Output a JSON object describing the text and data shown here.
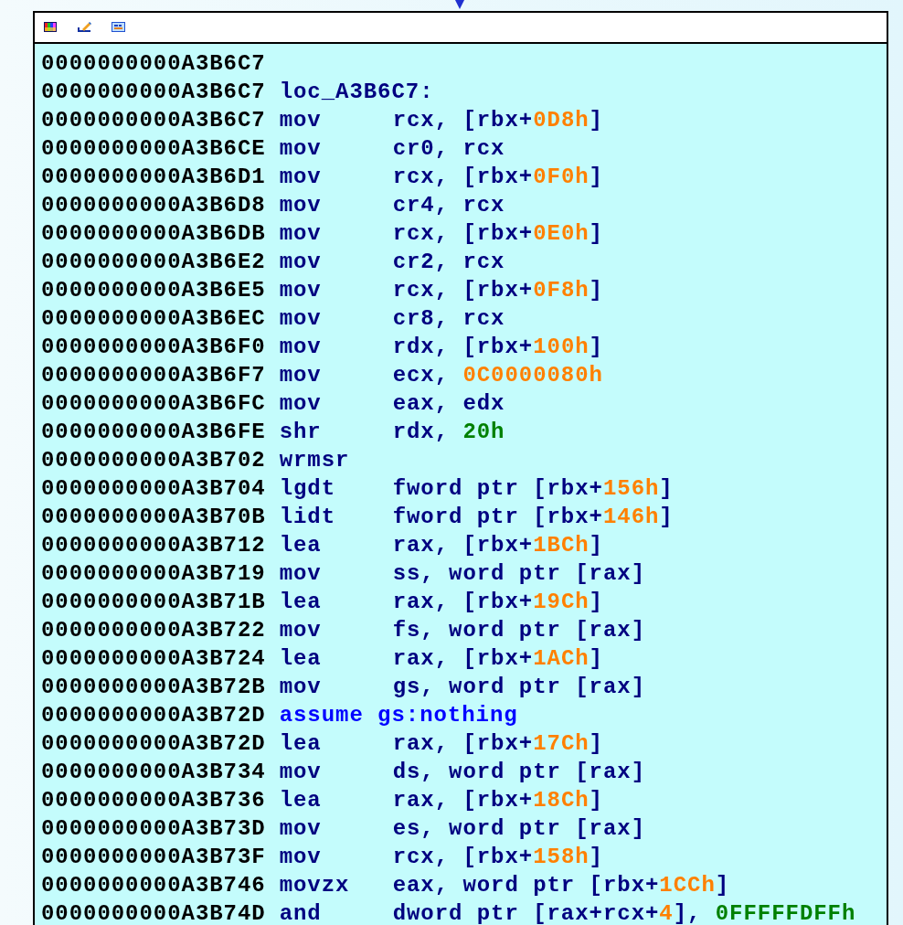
{
  "toolbar": {
    "icons": [
      {
        "kind": "palette"
      },
      {
        "kind": "pencil"
      },
      {
        "kind": "window"
      }
    ]
  },
  "lines": [
    {
      "address": "0000000000A3B6C7"
    },
    {
      "address": "0000000000A3B6C7",
      "parts": [
        {
          "kind": "label",
          "text": "loc_A3B6C7:"
        }
      ]
    },
    {
      "address": "0000000000A3B6C7",
      "parts": [
        {
          "kind": "mnemonic",
          "text": "mov"
        },
        {
          "kind": "text",
          "text": "rcx, [rbx+"
        },
        {
          "kind": "offset",
          "text": "0D8h"
        },
        {
          "kind": "text",
          "text": "]"
        }
      ]
    },
    {
      "address": "0000000000A3B6CE",
      "parts": [
        {
          "kind": "mnemonic",
          "text": "mov"
        },
        {
          "kind": "text",
          "text": "cr0, rcx"
        }
      ]
    },
    {
      "address": "0000000000A3B6D1",
      "parts": [
        {
          "kind": "mnemonic",
          "text": "mov"
        },
        {
          "kind": "text",
          "text": "rcx, [rbx+"
        },
        {
          "kind": "offset",
          "text": "0F0h"
        },
        {
          "kind": "text",
          "text": "]"
        }
      ]
    },
    {
      "address": "0000000000A3B6D8",
      "parts": [
        {
          "kind": "mnemonic",
          "text": "mov"
        },
        {
          "kind": "text",
          "text": "cr4, rcx"
        }
      ]
    },
    {
      "address": "0000000000A3B6DB",
      "parts": [
        {
          "kind": "mnemonic",
          "text": "mov"
        },
        {
          "kind": "text",
          "text": "rcx, [rbx+"
        },
        {
          "kind": "offset",
          "text": "0E0h"
        },
        {
          "kind": "text",
          "text": "]"
        }
      ]
    },
    {
      "address": "0000000000A3B6E2",
      "parts": [
        {
          "kind": "mnemonic",
          "text": "mov"
        },
        {
          "kind": "text",
          "text": "cr2, rcx"
        }
      ]
    },
    {
      "address": "0000000000A3B6E5",
      "parts": [
        {
          "kind": "mnemonic",
          "text": "mov"
        },
        {
          "kind": "text",
          "text": "rcx, [rbx+"
        },
        {
          "kind": "offset",
          "text": "0F8h"
        },
        {
          "kind": "text",
          "text": "]"
        }
      ]
    },
    {
      "address": "0000000000A3B6EC",
      "parts": [
        {
          "kind": "mnemonic",
          "text": "mov"
        },
        {
          "kind": "text",
          "text": "cr8, rcx"
        }
      ]
    },
    {
      "address": "0000000000A3B6F0",
      "parts": [
        {
          "kind": "mnemonic",
          "text": "mov"
        },
        {
          "kind": "text",
          "text": "rdx, [rbx+"
        },
        {
          "kind": "offset",
          "text": "100h"
        },
        {
          "kind": "text",
          "text": "]"
        }
      ]
    },
    {
      "address": "0000000000A3B6F7",
      "parts": [
        {
          "kind": "mnemonic",
          "text": "mov"
        },
        {
          "kind": "text",
          "text": "ecx, "
        },
        {
          "kind": "offset",
          "text": "0C0000080h"
        }
      ]
    },
    {
      "address": "0000000000A3B6FC",
      "parts": [
        {
          "kind": "mnemonic",
          "text": "mov"
        },
        {
          "kind": "text",
          "text": "eax, edx"
        }
      ]
    },
    {
      "address": "0000000000A3B6FE",
      "parts": [
        {
          "kind": "mnemonic",
          "text": "shr"
        },
        {
          "kind": "text",
          "text": "rdx, "
        },
        {
          "kind": "immediate",
          "text": "20h"
        }
      ]
    },
    {
      "address": "0000000000A3B702",
      "parts": [
        {
          "kind": "mnemonic",
          "text": "wrmsr"
        }
      ]
    },
    {
      "address": "0000000000A3B704",
      "parts": [
        {
          "kind": "mnemonic",
          "text": "lgdt"
        },
        {
          "kind": "text",
          "text": "fword ptr [rbx+"
        },
        {
          "kind": "offset",
          "text": "156h"
        },
        {
          "kind": "text",
          "text": "]"
        }
      ]
    },
    {
      "address": "0000000000A3B70B",
      "parts": [
        {
          "kind": "mnemonic",
          "text": "lidt"
        },
        {
          "kind": "text",
          "text": "fword ptr [rbx+"
        },
        {
          "kind": "offset",
          "text": "146h"
        },
        {
          "kind": "text",
          "text": "]"
        }
      ]
    },
    {
      "address": "0000000000A3B712",
      "parts": [
        {
          "kind": "mnemonic",
          "text": "lea"
        },
        {
          "kind": "text",
          "text": "rax, [rbx+"
        },
        {
          "kind": "offset",
          "text": "1BCh"
        },
        {
          "kind": "text",
          "text": "]"
        }
      ]
    },
    {
      "address": "0000000000A3B719",
      "parts": [
        {
          "kind": "mnemonic",
          "text": "mov"
        },
        {
          "kind": "text",
          "text": "ss, word ptr [rax]"
        }
      ]
    },
    {
      "address": "0000000000A3B71B",
      "parts": [
        {
          "kind": "mnemonic",
          "text": "lea"
        },
        {
          "kind": "text",
          "text": "rax, [rbx+"
        },
        {
          "kind": "offset",
          "text": "19Ch"
        },
        {
          "kind": "text",
          "text": "]"
        }
      ]
    },
    {
      "address": "0000000000A3B722",
      "parts": [
        {
          "kind": "mnemonic",
          "text": "mov"
        },
        {
          "kind": "text",
          "text": "fs, word ptr [rax]"
        }
      ]
    },
    {
      "address": "0000000000A3B724",
      "parts": [
        {
          "kind": "mnemonic",
          "text": "lea"
        },
        {
          "kind": "text",
          "text": "rax, [rbx+"
        },
        {
          "kind": "offset",
          "text": "1ACh"
        },
        {
          "kind": "text",
          "text": "]"
        }
      ]
    },
    {
      "address": "0000000000A3B72B",
      "parts": [
        {
          "kind": "mnemonic",
          "text": "mov"
        },
        {
          "kind": "text",
          "text": "gs, word ptr [rax]"
        }
      ]
    },
    {
      "address": "0000000000A3B72D",
      "parts": [
        {
          "kind": "directive",
          "text": "assume gs:nothing"
        }
      ]
    },
    {
      "address": "0000000000A3B72D",
      "parts": [
        {
          "kind": "mnemonic",
          "text": "lea"
        },
        {
          "kind": "text",
          "text": "rax, [rbx+"
        },
        {
          "kind": "offset",
          "text": "17Ch"
        },
        {
          "kind": "text",
          "text": "]"
        }
      ]
    },
    {
      "address": "0000000000A3B734",
      "parts": [
        {
          "kind": "mnemonic",
          "text": "mov"
        },
        {
          "kind": "text",
          "text": "ds, word ptr [rax]"
        }
      ]
    },
    {
      "address": "0000000000A3B736",
      "parts": [
        {
          "kind": "mnemonic",
          "text": "lea"
        },
        {
          "kind": "text",
          "text": "rax, [rbx+"
        },
        {
          "kind": "offset",
          "text": "18Ch"
        },
        {
          "kind": "text",
          "text": "]"
        }
      ]
    },
    {
      "address": "0000000000A3B73D",
      "parts": [
        {
          "kind": "mnemonic",
          "text": "mov"
        },
        {
          "kind": "text",
          "text": "es, word ptr [rax]"
        }
      ]
    },
    {
      "address": "0000000000A3B73F",
      "parts": [
        {
          "kind": "mnemonic",
          "text": "mov"
        },
        {
          "kind": "text",
          "text": "rcx, [rbx+"
        },
        {
          "kind": "offset",
          "text": "158h"
        },
        {
          "kind": "text",
          "text": "]"
        }
      ]
    },
    {
      "address": "0000000000A3B746",
      "parts": [
        {
          "kind": "mnemonic",
          "text": "movzx"
        },
        {
          "kind": "text",
          "text": "eax, word ptr [rbx+"
        },
        {
          "kind": "offset",
          "text": "1CCh"
        },
        {
          "kind": "text",
          "text": "]"
        }
      ]
    },
    {
      "address": "0000000000A3B74D",
      "parts": [
        {
          "kind": "mnemonic",
          "text": "and"
        },
        {
          "kind": "text",
          "text": "dword ptr [rax+rcx+"
        },
        {
          "kind": "offset",
          "text": "4"
        },
        {
          "kind": "text",
          "text": "], "
        },
        {
          "kind": "immediate",
          "text": "0FFFFFDFFh"
        }
      ]
    }
  ]
}
